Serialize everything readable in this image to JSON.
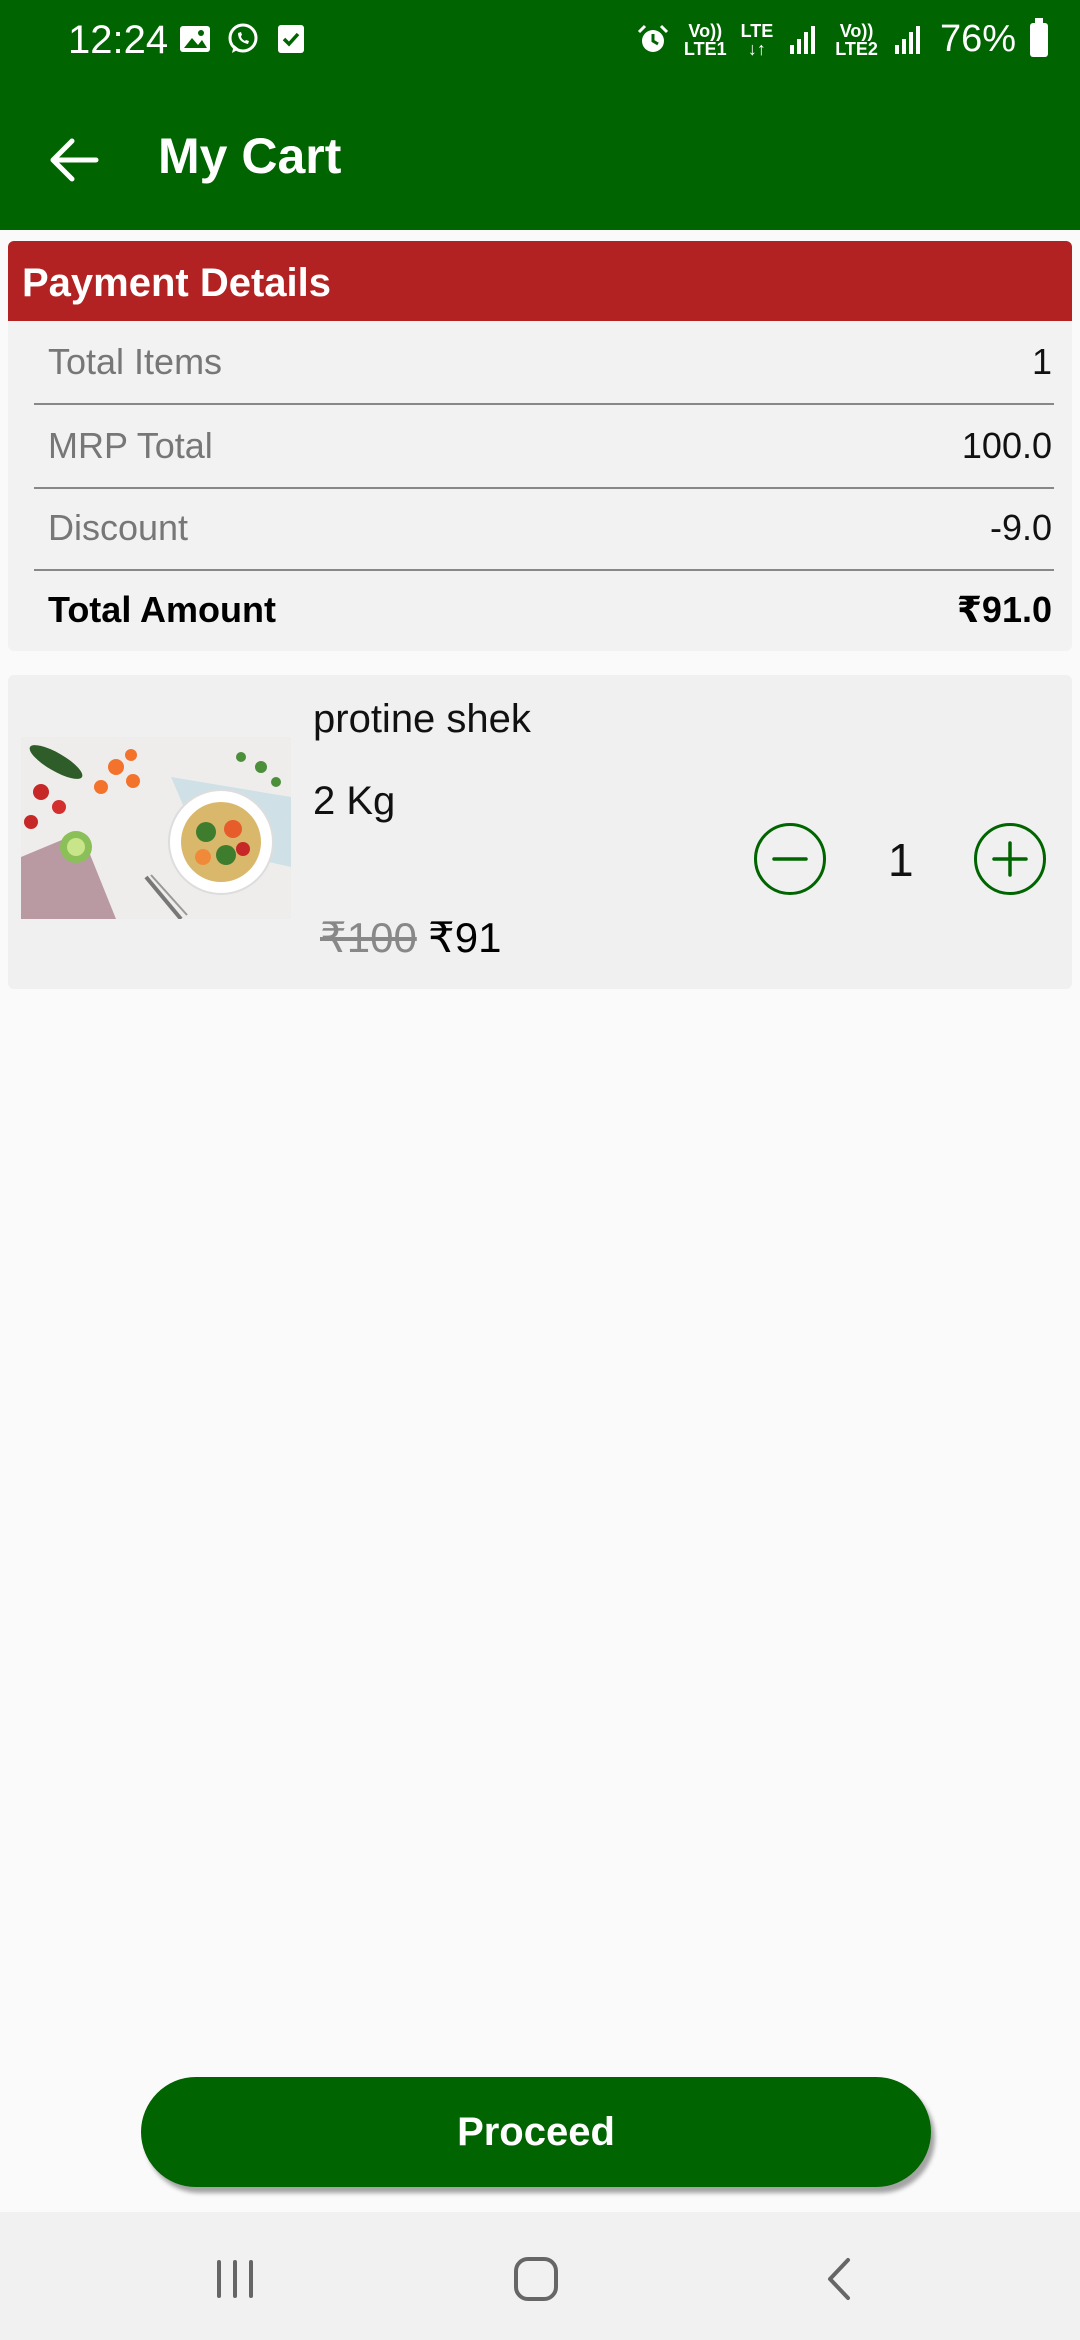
{
  "status_bar": {
    "time": "12:24",
    "net1_top": "Vo)) ",
    "net1_bottom": "LTE1",
    "net_mid_top": "LTE",
    "net_mid_bottom": "↓↑",
    "net2_top": "Vo))",
    "net2_bottom": "LTE2",
    "battery": "76%"
  },
  "app_bar": {
    "title": "My Cart"
  },
  "payment": {
    "header": "Payment Details",
    "rows": [
      {
        "label": "Total Items",
        "value": "1"
      },
      {
        "label": "MRP Total",
        "value": "100.0"
      },
      {
        "label": "Discount",
        "value": "-9.0"
      },
      {
        "label": "Total Amount",
        "value": "₹91.0"
      }
    ]
  },
  "cart": {
    "items": [
      {
        "name": "protine shek",
        "weight": "2 Kg",
        "mrp": "₹100",
        "price": "₹91",
        "quantity": "1"
      }
    ]
  },
  "actions": {
    "proceed": "Proceed"
  },
  "colors": {
    "primary": "#006400",
    "header_red": "#b22222",
    "background": "#fafafa"
  },
  "icons": [
    "image-icon",
    "whatsapp-icon",
    "checkbox-icon",
    "alarm-icon",
    "signal-icon",
    "battery-icon",
    "back-arrow-icon",
    "minus-icon",
    "plus-icon",
    "recents-icon",
    "home-icon",
    "back-icon"
  ]
}
